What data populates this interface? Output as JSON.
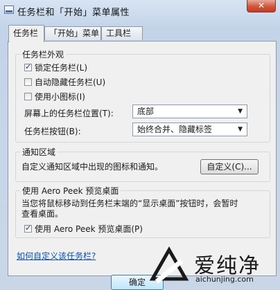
{
  "window": {
    "title": "任务栏和「开始」菜单属性",
    "close_label": "✕"
  },
  "tabs": [
    {
      "label": "任务栏",
      "active": true
    },
    {
      "label": "「开始」菜单",
      "active": false
    },
    {
      "label": "工具栏",
      "active": false
    }
  ],
  "appearance": {
    "title": "任务栏外观",
    "lock": {
      "label": "锁定任务栏(L)",
      "checked": true
    },
    "autohide": {
      "label": "自动隐藏任务栏(U)",
      "checked": false
    },
    "small_icons": {
      "label": "使用小图标(I)",
      "checked": false
    },
    "position": {
      "label": "屏幕上的任务栏位置(T):",
      "value": "底部"
    },
    "buttons": {
      "label": "任务栏按钮(B):",
      "value": "始终合并、隐藏标签"
    }
  },
  "notification": {
    "title": "通知区域",
    "text": "自定义通知区域中出现的图标和通知。",
    "customize_label": "自定义(C)..."
  },
  "aero": {
    "title": "使用 Aero Peek 预览桌面",
    "description_line1": "当您将鼠标移动到任务栏末端的“显示桌面”按钮时，会暂时",
    "description_line2": "查看桌面。",
    "checkbox": {
      "label": "使用 Aero Peek 预览桌面(P)",
      "checked": true
    }
  },
  "help_link": "如何自定义该任务栏?",
  "ok_label": "确定",
  "watermark": {
    "text": "爱纯净",
    "url": "aichunjing.com"
  }
}
